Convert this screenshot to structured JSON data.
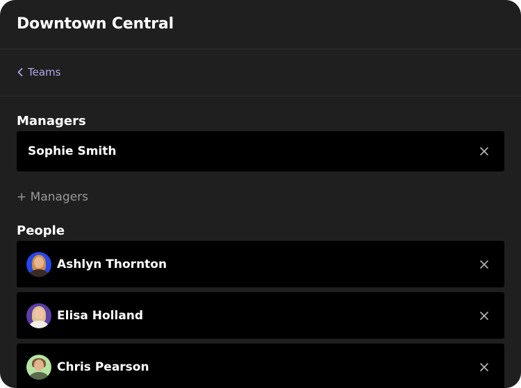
{
  "header": {
    "title": "Downtown Central"
  },
  "nav": {
    "back_label": "Teams"
  },
  "managers": {
    "section_title": "Managers",
    "items": [
      {
        "name": "Sophie Smith"
      }
    ],
    "add_label": "+ Managers"
  },
  "people": {
    "section_title": "People",
    "items": [
      {
        "name": "Ashlyn Thornton",
        "avatar_bg": "#2747e8"
      },
      {
        "name": "Elisa Holland",
        "avatar_bg": "#5b3fa8"
      },
      {
        "name": "Chris Pearson",
        "avatar_bg": "#b6e3a3"
      }
    ]
  },
  "colors": {
    "panel_bg": "#1f1f1f",
    "card_bg": "#000000",
    "accent_link": "#b3a6ea",
    "muted_text": "#9a9a9a"
  }
}
